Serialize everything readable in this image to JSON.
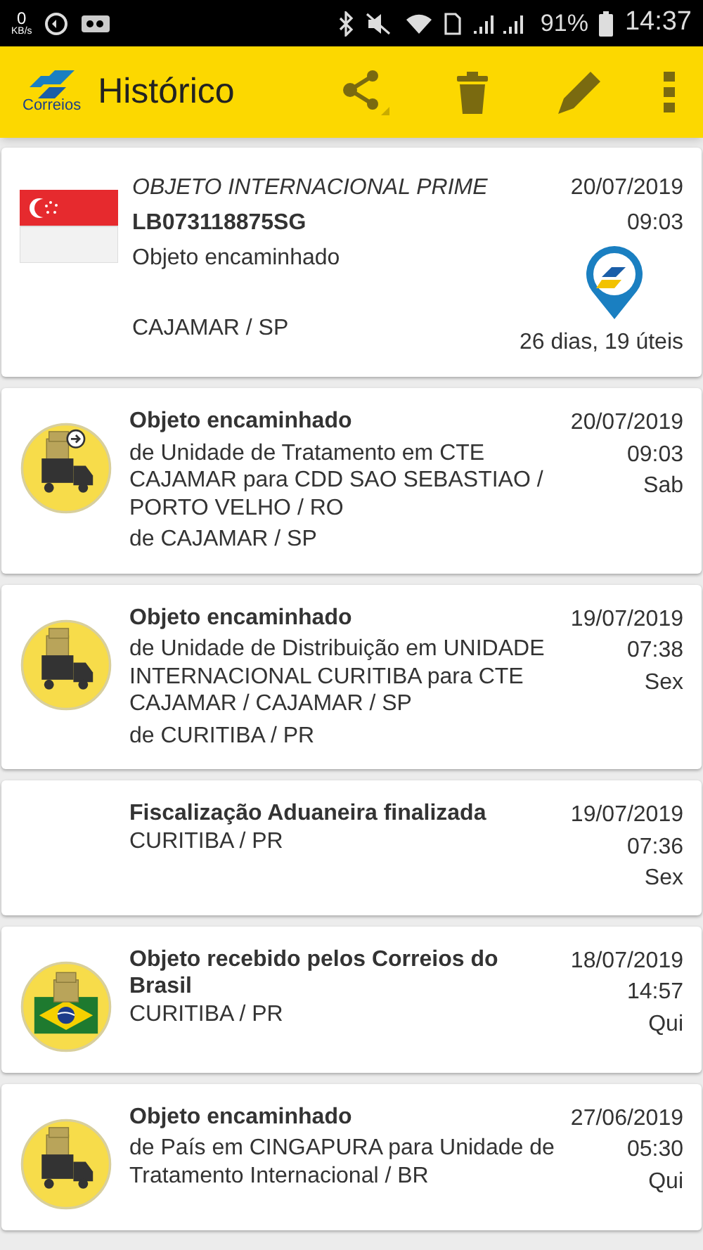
{
  "status_bar": {
    "speed_value": "0",
    "speed_unit": "KB/s",
    "battery": "91%",
    "time": "14:37"
  },
  "toolbar": {
    "title": "Histórico",
    "logo_text": "Correios"
  },
  "summary": {
    "category": "OBJETO INTERNACIONAL PRIME",
    "code": "LB073118875SG",
    "status": "Objeto encaminhado",
    "location": "CAJAMAR / SP",
    "date": "20/07/2019",
    "time": "09:03",
    "elapsed": "26 dias, 19 úteis"
  },
  "events": [
    {
      "kind": "truck_arrow",
      "title": "Objeto encaminhado",
      "detail": "de Unidade de Tratamento em CTE CAJAMAR para CDD SAO SEBASTIAO / PORTO VELHO / RO",
      "location": "de CAJAMAR / SP",
      "date": "20/07/2019",
      "time": "09:03",
      "weekday": "Sab"
    },
    {
      "kind": "truck",
      "title": "Objeto encaminhado",
      "detail": "de Unidade de Distribuição em UNIDADE INTERNACIONAL CURITIBA para CTE CAJAMAR / CAJAMAR / SP",
      "location": "de CURITIBA / PR",
      "date": "19/07/2019",
      "time": "07:38",
      "weekday": "Sex"
    },
    {
      "kind": "none",
      "title": "Fiscalização Aduaneira finalizada",
      "location": "CURITIBA / PR",
      "date": "19/07/2019",
      "time": "07:36",
      "weekday": "Sex"
    },
    {
      "kind": "brazil",
      "title": "Objeto recebido pelos Correios do Brasil",
      "location": "CURITIBA / PR",
      "date": "18/07/2019",
      "time": "14:57",
      "weekday": "Qui"
    },
    {
      "kind": "truck",
      "title": "Objeto encaminhado",
      "detail": "de País em CINGAPURA para Unidade de Tratamento Internacional / BR",
      "date": "27/06/2019",
      "time": "05:30",
      "weekday": "Qui"
    }
  ]
}
